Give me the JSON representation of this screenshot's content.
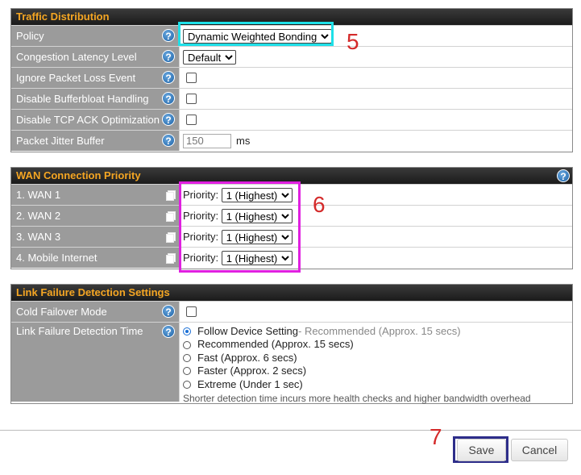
{
  "traffic": {
    "title": "Traffic Distribution",
    "rows": [
      {
        "label": "Policy",
        "value": "Dynamic Weighted Bonding"
      },
      {
        "label": "Congestion Latency Level",
        "value": "Default"
      },
      {
        "label": "Ignore Packet Loss Event"
      },
      {
        "label": "Disable Bufferbloat Handling"
      },
      {
        "label": "Disable TCP ACK Optimization"
      },
      {
        "label": "Packet Jitter Buffer",
        "placeholder": "150",
        "unit": "ms"
      }
    ]
  },
  "wan": {
    "title": "WAN Connection Priority",
    "priority_label": "Priority:",
    "rows": [
      {
        "label": "1. WAN 1",
        "value": "1 (Highest)"
      },
      {
        "label": "2. WAN 2",
        "value": "1 (Highest)"
      },
      {
        "label": "3. WAN 3",
        "value": "1 (Highest)"
      },
      {
        "label": "4. Mobile Internet",
        "value": "1 (Highest)"
      }
    ]
  },
  "lfd": {
    "title": "Link Failure Detection Settings",
    "cold_label": "Cold Failover Mode",
    "time_label": "Link Failure Detection Time",
    "options": [
      {
        "label": "Follow Device Setting",
        "suffix": " - Recommended (Approx. 15 secs)",
        "selected": true
      },
      {
        "label": "Recommended (Approx. 15 secs)",
        "suffix": "",
        "selected": false
      },
      {
        "label": "Fast (Approx. 6 secs)",
        "suffix": "",
        "selected": false
      },
      {
        "label": "Faster (Approx. 2 secs)",
        "suffix": "",
        "selected": false
      },
      {
        "label": "Extreme (Under 1 sec)",
        "suffix": "",
        "selected": false
      }
    ],
    "note": "Shorter detection time incurs more health checks and higher bandwidth overhead"
  },
  "buttons": {
    "save": "Save",
    "cancel": "Cancel"
  },
  "callouts": {
    "policy": "5",
    "priority": "6",
    "save": "7"
  },
  "colors": {
    "header_text": "#f5a623",
    "callout_red": "#d42a2a",
    "highlight_cyan": "#1ee0e8",
    "highlight_magenta": "#e020e0",
    "highlight_navy": "#2e2e8a"
  }
}
